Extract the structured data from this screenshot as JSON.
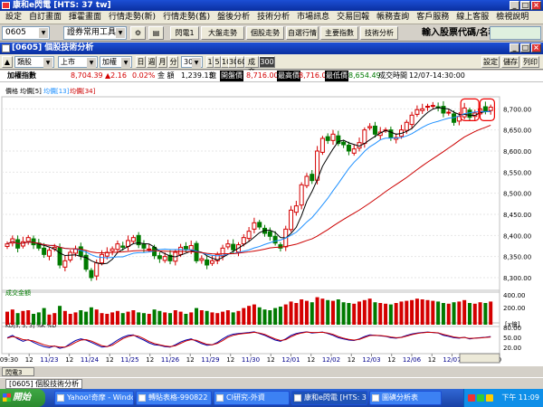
{
  "app": {
    "title": "康和e閃電 [HTS: 37 tw]"
  },
  "menu": [
    "設定",
    "自訂畫面",
    "揮霍畫面",
    "行情走勢(新)",
    "行情走勢(舊)",
    "盤後分析",
    "技術分析",
    "市場訊息",
    "交易回報",
    "帳務查詢",
    "客戶服務",
    "線上客服",
    "檢視說明"
  ],
  "toolbar": {
    "code": "0605",
    "tool_select": "證券常用工具",
    "buttons": [
      "閃電1",
      "大盤走勢",
      "個股走勢",
      "自選行情",
      "主要指數",
      "技術分析"
    ],
    "symbol_label": "輸入股票代碼/名稱:"
  },
  "window": {
    "title": "[0605] 個股技術分析"
  },
  "controls": {
    "type_select": "類股",
    "market_select": "上市",
    "item_select": "加權",
    "periods": [
      "日",
      "週",
      "月",
      "分"
    ],
    "minute_select": "30",
    "intervals": [
      "1",
      "5",
      "10",
      "30",
      "60"
    ],
    "tick_button": "成交",
    "count_value": "300",
    "right_buttons": [
      "設定",
      "儲存",
      "列印"
    ]
  },
  "info": {
    "name": "加權指數",
    "price": "8,704.39",
    "change": "▲2.16",
    "pct": "0.02%",
    "amount_label": "金 額",
    "amount": "1,239.13",
    "amount_unit": "億",
    "open_label": "開盤價",
    "open": "8,716.00",
    "high_label": "最高價",
    "high": "8,716.00",
    "low_label": "最低價",
    "low": "8,654.49",
    "time_label": "成交時間",
    "time": "12/07-14:30:00"
  },
  "panels": {
    "price_legend": {
      "label": "價格",
      "ma_label": "均價",
      "items": [
        "均價[5]",
        "均價[13]",
        "均價[34]"
      ]
    },
    "volume_label": "成交金額",
    "volume_unit": "[x億]",
    "volume_ticks": [
      "400.00",
      "200.00"
    ],
    "kd_label": "KD[5, 3, 3] %K %D",
    "kd_ticks": [
      "80.00",
      "50.00",
      "20.00"
    ]
  },
  "colors": {
    "up": "#d40000",
    "down": "#007a00",
    "ma5": "#000000",
    "ma13": "#1e90ff",
    "ma34": "#cc0000",
    "k": "#0000aa",
    "d": "#cc0000"
  },
  "chart_data": {
    "type": "candlestick",
    "title": "加權指數",
    "y_ticks": [
      8300,
      8350,
      8400,
      8450,
      8500,
      8550,
      8600,
      8650,
      8700
    ],
    "ylim": [
      8270,
      8720
    ],
    "x_labels": [
      "09:30",
      "12",
      "11/23",
      "12",
      "11/24",
      "12",
      "11/25",
      "12",
      "11/26",
      "12",
      "11/29",
      "12",
      "11/30",
      "12",
      "12/01",
      "12",
      "12/02",
      "12",
      "12/03",
      "12",
      "12/06",
      "12",
      "12/07",
      "12",
      "13:30"
    ],
    "close": [
      8380,
      8392,
      8370,
      8385,
      8395,
      8378,
      8370,
      8355,
      8365,
      8372,
      8330,
      8340,
      8360,
      8368,
      8352,
      8320,
      8300,
      8335,
      8355,
      8360,
      8368,
      8380,
      8372,
      8388,
      8395,
      8378,
      8370,
      8368,
      8352,
      8345,
      8350,
      8340,
      8360,
      8372,
      8368,
      8376,
      8340,
      8345,
      8330,
      8340,
      8355,
      8370,
      8380,
      8366,
      8378,
      8395,
      8410,
      8430,
      8420,
      8405,
      8398,
      8382,
      8370,
      8415,
      8460,
      8470,
      8520,
      8540,
      8530,
      8600,
      8630,
      8625,
      8640,
      8618,
      8615,
      8600,
      8605,
      8620,
      8650,
      8658,
      8640,
      8645,
      8650,
      8632,
      8632,
      8650,
      8668,
      8685,
      8698,
      8700,
      8706,
      8708,
      8702,
      8690,
      8692,
      8668,
      8682,
      8702,
      8680,
      8690,
      8700,
      8695,
      8704
    ],
    "volume": [
      180,
      210,
      160,
      190,
      200,
      150,
      170,
      230,
      140,
      160,
      260,
      190,
      150,
      170,
      200,
      180,
      240,
      210,
      160,
      150,
      170,
      190,
      160,
      180,
      200,
      170,
      160,
      150,
      210,
      190,
      170,
      160,
      200,
      180,
      150,
      170,
      230,
      200,
      190,
      170,
      160,
      180,
      200,
      170,
      190,
      230,
      260,
      280,
      240,
      210,
      200,
      230,
      250,
      280,
      320,
      300,
      350,
      330,
      310,
      380,
      360,
      340,
      330,
      350,
      310,
      300,
      290,
      320,
      340,
      360,
      310,
      300,
      290,
      280,
      300,
      320,
      330,
      340,
      360,
      350,
      340,
      330,
      320,
      300,
      290,
      310,
      320,
      340,
      300,
      290,
      310,
      300,
      320
    ],
    "k": [
      60,
      70,
      55,
      45,
      52,
      40,
      30,
      22,
      18,
      25,
      15,
      20,
      35,
      48,
      55,
      50,
      40,
      30,
      20,
      22,
      35,
      50,
      62,
      70,
      72,
      60,
      50,
      38,
      30,
      28,
      22,
      20,
      30,
      42,
      50,
      55,
      45,
      35,
      28,
      30,
      40,
      55,
      68,
      75,
      78,
      80,
      82,
      85,
      78,
      70,
      60,
      50,
      45,
      55,
      70,
      78,
      82,
      85,
      80,
      82,
      84,
      78,
      70,
      60,
      55,
      50,
      48,
      55,
      65,
      72,
      70,
      68,
      66,
      60,
      58,
      62,
      70,
      76,
      80,
      82,
      84,
      82,
      80,
      70,
      66,
      60,
      58,
      62,
      55,
      58,
      60,
      62,
      65
    ],
    "d": [
      58,
      65,
      60,
      52,
      50,
      46,
      38,
      30,
      24,
      24,
      20,
      20,
      28,
      40,
      50,
      52,
      46,
      36,
      26,
      22,
      28,
      42,
      56,
      65,
      70,
      66,
      56,
      44,
      35,
      30,
      25,
      22,
      26,
      36,
      46,
      52,
      49,
      40,
      32,
      30,
      36,
      48,
      62,
      70,
      75,
      78,
      80,
      83,
      80,
      74,
      64,
      55,
      48,
      52,
      64,
      74,
      80,
      84,
      82,
      82,
      83,
      80,
      74,
      65,
      58,
      53,
      50,
      53,
      61,
      69,
      70,
      69,
      67,
      63,
      60,
      61,
      67,
      73,
      78,
      81,
      83,
      82,
      81,
      74,
      69,
      63,
      60,
      61,
      57,
      58,
      59,
      61,
      63
    ]
  }
}
